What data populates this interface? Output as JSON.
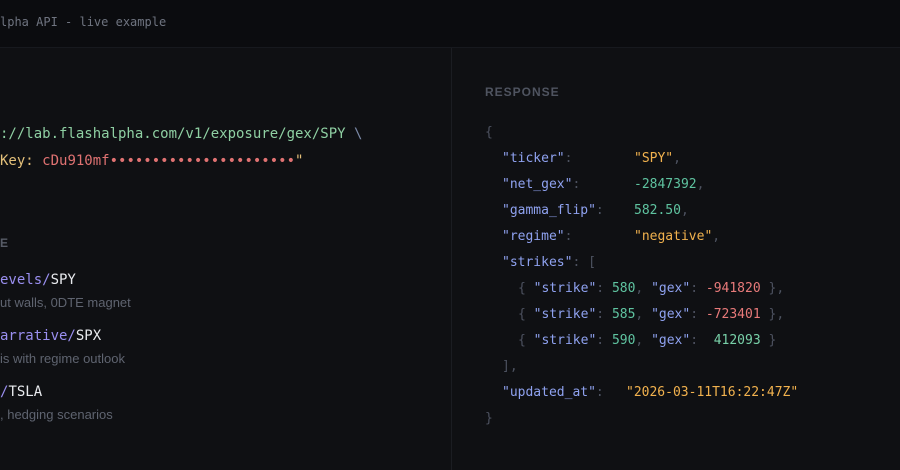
{
  "header": {
    "title": "lpha API - live example"
  },
  "request": {
    "url": "://lab.flashalpha.com/v1/exposure/gex/SPY",
    "continuation": "\\",
    "header_key": "Key:",
    "header_value": "cDu910mf••••••••••••••••••••••",
    "header_close": "\""
  },
  "examples": {
    "section_label": "E",
    "items": [
      {
        "path": "evels/",
        "ticker": "SPY",
        "desc": "ut walls, 0DTE magnet"
      },
      {
        "path": "arrative/",
        "ticker": "SPX",
        "desc": "is with regime outlook"
      },
      {
        "path": "/",
        "ticker": "TSLA",
        "desc": ", hedging scenarios"
      }
    ]
  },
  "response": {
    "label": "RESPONSE",
    "open_brace": "{",
    "close_brace": "}",
    "ticker_key": "\"ticker\"",
    "ticker_val": "\"SPY\"",
    "net_gex_key": "\"net_gex\"",
    "net_gex_val": "-2847392",
    "gamma_flip_key": "\"gamma_flip\"",
    "gamma_flip_val": "582.50",
    "regime_key": "\"regime\"",
    "regime_val": "\"negative\"",
    "strikes_key": "\"strikes\"",
    "strikes_open": "[",
    "strikes_close": "],",
    "strike_key": "\"strike\"",
    "gex_key": "\"gex\"",
    "rows": [
      {
        "strike": "580",
        "gex": "-941820"
      },
      {
        "strike": "585",
        "gex": "-723401"
      },
      {
        "strike": "590",
        "gex": "412093"
      }
    ],
    "updated_key": "\"updated_at\"",
    "updated_val": "\"2026-03-11T16:22:47Z\""
  },
  "colors": {
    "background": "#0f1013",
    "key": "#8fa2f0",
    "string": "#f2b24e",
    "number": "#5fc3a0",
    "negative": "#e87a7a"
  }
}
